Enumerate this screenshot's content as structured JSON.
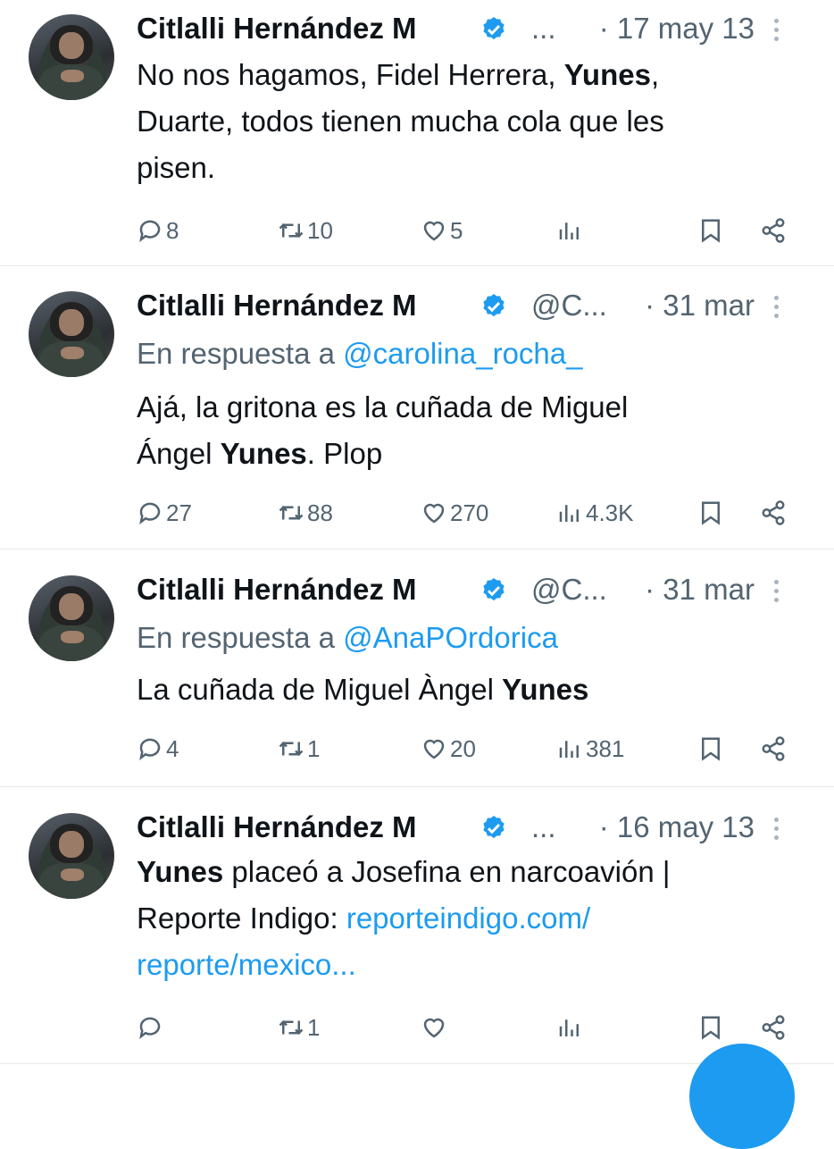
{
  "tweets": [
    {
      "name": "Citlalli Hernández M",
      "handle": "...",
      "date": "· 17 may 13",
      "reply_prefix": "",
      "reply_to": "",
      "text_parts": [
        "No nos hagamos, Fidel Herrera, ",
        "Yunes",
        ","
      ],
      "text_line2": "Duarte, todos tienen mucha cola que les",
      "text_line3": "pisen.",
      "replies": "8",
      "retweets": "10",
      "likes": "5",
      "views": ""
    },
    {
      "name": "Citlalli Hernández M",
      "handle": "@C...",
      "date": "· 31 mar",
      "reply_prefix": "En respuesta a ",
      "reply_to": "@carolina_rocha_",
      "text_line1": "Ajá, la gritona es la cuñada de Miguel",
      "text_parts2": [
        "Ángel ",
        "Yunes",
        ". Plop"
      ],
      "replies": "27",
      "retweets": "88",
      "likes": "270",
      "views": "4.3K"
    },
    {
      "name": "Citlalli Hernández M",
      "handle": "@C...",
      "date": "· 31 mar",
      "reply_prefix": "En respuesta a ",
      "reply_to": "@AnaPOrdorica",
      "text_parts": [
        "La cuñada de Miguel Àngel ",
        "Yunes"
      ],
      "replies": "4",
      "retweets": "1",
      "likes": "20",
      "views": "381"
    },
    {
      "name": "Citlalli Hernández M",
      "handle": "...",
      "date": "· 16 may 13",
      "text_parts": [
        "Yunes",
        " placeó a Josefina en narcoavión |"
      ],
      "text_line2a": "Reporte Indigo: ",
      "text_link1": "reporteindigo.com/",
      "text_link2": "reporte/mexico...",
      "replies": "",
      "retweets": "1",
      "likes": "",
      "views": ""
    }
  ],
  "icons": {
    "verified": "verified-badge-icon",
    "reply": "reply-icon",
    "retweet": "retweet-icon",
    "like": "heart-icon",
    "views": "views-icon",
    "bookmark": "bookmark-icon",
    "share": "share-icon",
    "more": "more-icon"
  },
  "colors": {
    "accent": "#1d9bf0",
    "muted": "#536471",
    "text": "#0f1419"
  }
}
